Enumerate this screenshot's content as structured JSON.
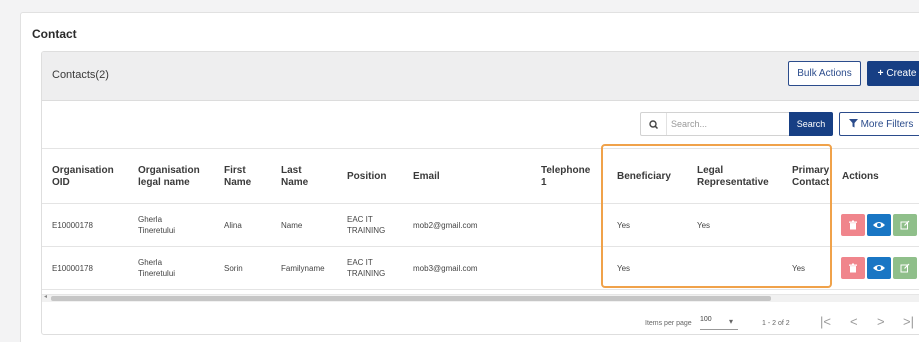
{
  "page": {
    "section_title": "Contact"
  },
  "card": {
    "title": "Contacts(2)",
    "bulk_actions_label": "Bulk Actions",
    "create_label": "Create",
    "create_icon": "+"
  },
  "search": {
    "placeholder": "Search...",
    "button_label": "Search",
    "more_filters_label": "More Filters"
  },
  "table": {
    "headers": {
      "org_oid": [
        "Organisation",
        "OID"
      ],
      "org_name": [
        "Organisation",
        "legal name"
      ],
      "first_name": [
        "First",
        "Name"
      ],
      "last_name": [
        "Last",
        "Name"
      ],
      "position": [
        "Position"
      ],
      "email": [
        "Email"
      ],
      "telephone": [
        "Telephone",
        "1"
      ],
      "beneficiary": [
        "Beneficiary"
      ],
      "legal_rep": [
        "Legal",
        "Representative"
      ],
      "primary": [
        "Primary",
        "Contact"
      ],
      "actions": [
        "Actions"
      ]
    },
    "rows": [
      {
        "org_oid": "E10000178",
        "org_name": [
          "Gherla",
          "Tineretului"
        ],
        "first_name": "Alina",
        "last_name": "Name",
        "position": [
          "EAC IT",
          "TRAINING"
        ],
        "email": "mob2@gmail.com",
        "telephone": "",
        "beneficiary": "Yes",
        "legal_rep": "Yes",
        "primary": ""
      },
      {
        "org_oid": "E10000178",
        "org_name": [
          "Gherla",
          "Tineretului"
        ],
        "first_name": "Sorin",
        "last_name": "Familyname",
        "position": [
          "EAC IT",
          "TRAINING"
        ],
        "email": "mob3@gmail.com",
        "telephone": "",
        "beneficiary": "Yes",
        "legal_rep": "",
        "primary": "Yes"
      }
    ]
  },
  "pagination": {
    "items_per_page_label": "Items per page",
    "items_per_page_value": "100",
    "range_label": "1 - 2 of 2",
    "first_icon": "|<",
    "prev_icon": "<",
    "next_icon": ">",
    "last_icon": ">|"
  },
  "icons": {
    "search": "search-icon",
    "filter": "filter-icon",
    "delete": "trash-icon",
    "view": "eye-icon",
    "edit": "edit-icon"
  },
  "colors": {
    "primary": "#173f84",
    "delete": "#f0858c",
    "view": "#1976c4",
    "edit": "#8fbf8a",
    "highlight": "#f0a24a"
  }
}
